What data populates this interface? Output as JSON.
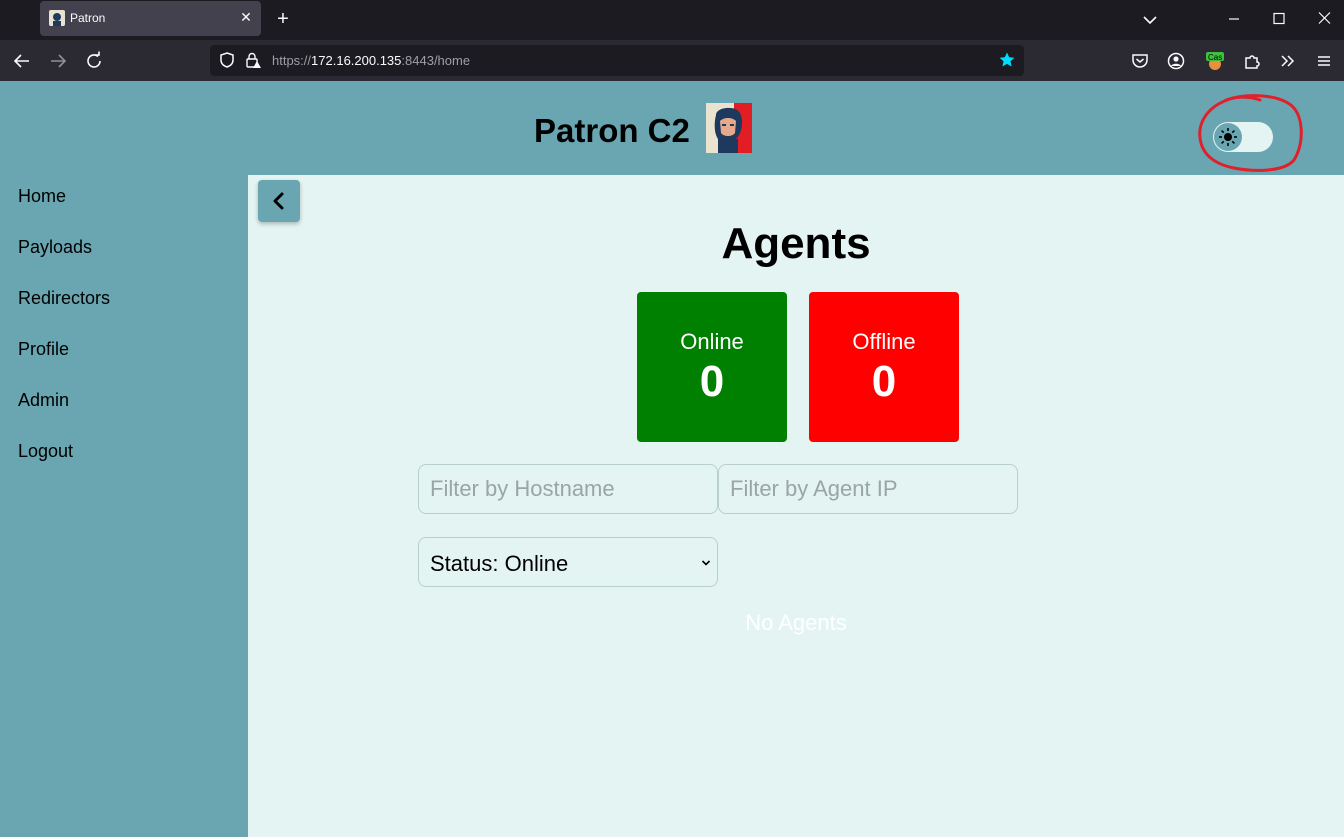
{
  "browser": {
    "tab_title": "Patron",
    "tab_close": "✕",
    "new_tab": "+",
    "url_scheme": "https://",
    "url_host": "172.16.200.135",
    "url_rest": ":8443/home",
    "extension_badge": "Cas"
  },
  "header": {
    "title": "Patron C2"
  },
  "sidebar": {
    "items": [
      {
        "label": "Home"
      },
      {
        "label": "Payloads"
      },
      {
        "label": "Redirectors"
      },
      {
        "label": "Profile"
      },
      {
        "label": "Admin"
      },
      {
        "label": "Logout"
      }
    ]
  },
  "main": {
    "title": "Agents",
    "online": {
      "label": "Online",
      "count": "0"
    },
    "offline": {
      "label": "Offline",
      "count": "0"
    },
    "filter_hostname_placeholder": "Filter by Hostname",
    "filter_ip_placeholder": "Filter by Agent IP",
    "status_select": "Status: Online",
    "empty_message": "No Agents"
  },
  "colors": {
    "accent": "#69a6b1",
    "background": "#e4f4f2",
    "online": "#008000",
    "offline": "#ff0000",
    "annotation": "#e0202a"
  },
  "icons": {
    "theme_toggle": "sun-icon",
    "collapse": "chevron-left-icon"
  }
}
